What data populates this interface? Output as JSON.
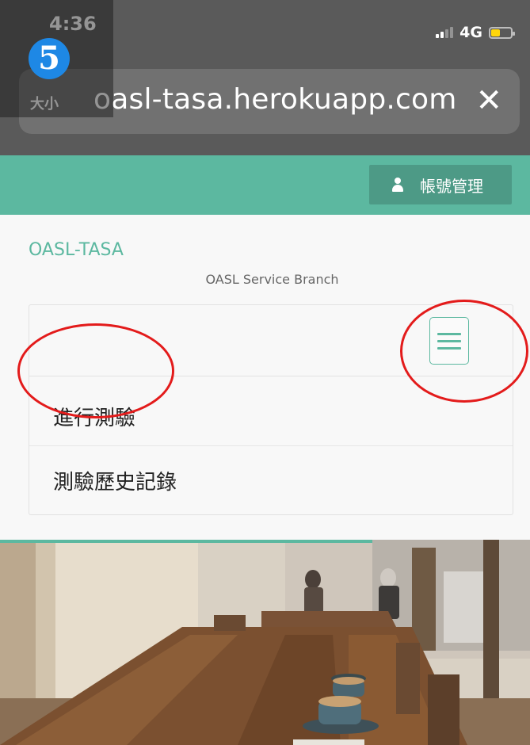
{
  "status_bar": {
    "time": "4:36",
    "network": "4G"
  },
  "annotation": {
    "step_number": "5"
  },
  "browser": {
    "text_size_label": "大小",
    "url": "oasl-tasa.herokuapp.com",
    "close_glyph": "✕"
  },
  "header": {
    "account_button_label": "帳號管理"
  },
  "site": {
    "brand": "OASL-TASA",
    "tagline": "OASL Service Branch"
  },
  "nav": {
    "items": [
      {
        "label": "進行測驗"
      },
      {
        "label": "測驗歷史記錄"
      }
    ]
  },
  "colors": {
    "accent": "#5cb8a0",
    "accent_dark": "#4d9a86",
    "annotation_red": "#e31b1b",
    "badge_blue": "#1e88e5"
  }
}
